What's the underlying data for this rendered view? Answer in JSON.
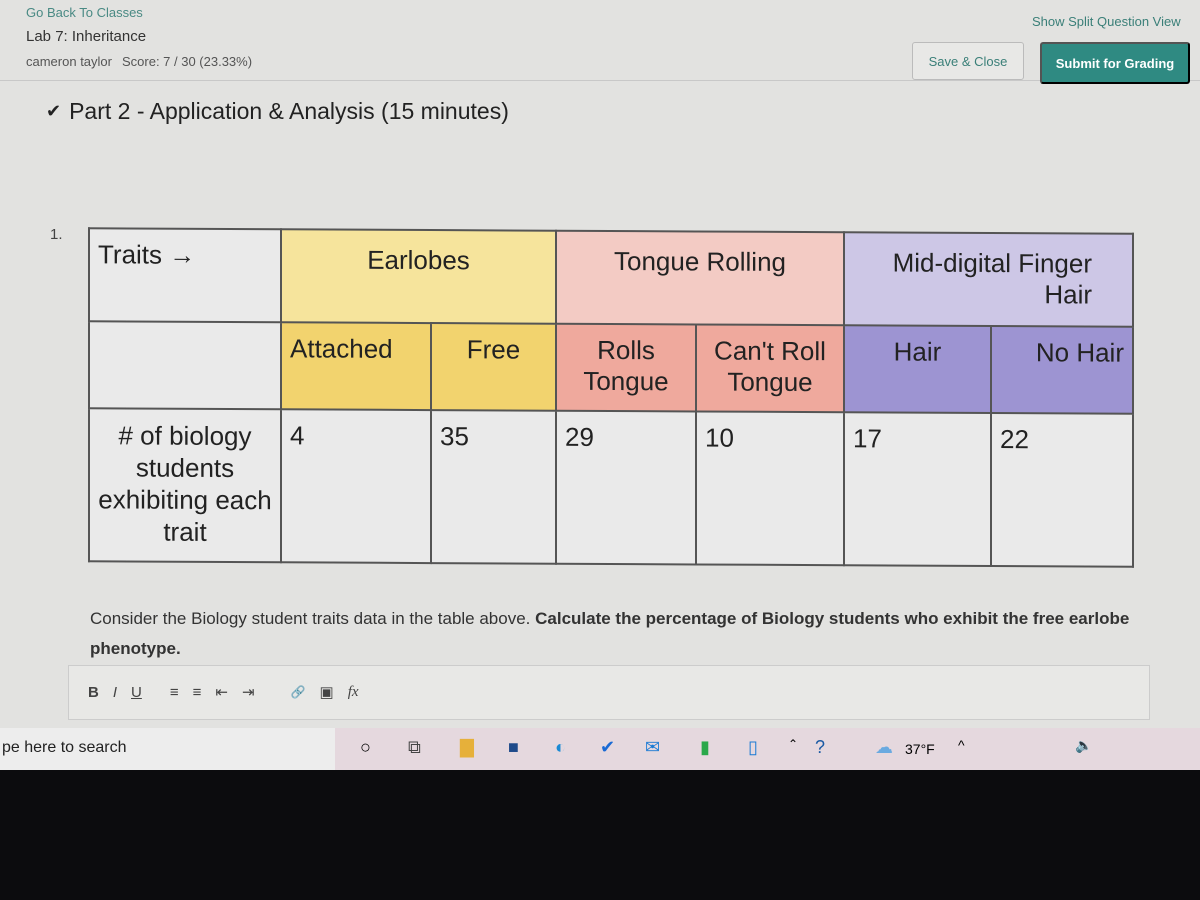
{
  "header": {
    "back_link": "Go Back To Classes",
    "title": "Lab 7: Inheritance",
    "user": "cameron taylor",
    "score": "Score:  7 / 30 (23.33%)",
    "split_view": "Show Split Question View",
    "save_close": "Save & Close",
    "submit": "Submit for Grading"
  },
  "section": {
    "title": "Part 2 - Application & Analysis (15 minutes)"
  },
  "question": {
    "number": "1.",
    "prompt_plain": "Consider the Biology student traits data in the table above.",
    "prompt_bold": "Calculate the percentage of Biology students who exhibit the free earlobe phenotype."
  },
  "table": {
    "traits_label": "Traits →",
    "groups": [
      "Earlobes",
      "Tongue Rolling",
      "Mid-digital Finger Hair"
    ],
    "subheaders": [
      "Attached",
      "Free",
      "Rolls Tongue",
      "Can't Roll Tongue",
      "Hair",
      "No Hair"
    ],
    "row_label": "# of biology students exhibiting each trait",
    "values": [
      "4",
      "35",
      "29",
      "10",
      "17",
      "22"
    ]
  },
  "editor": {
    "tools": [
      "B",
      "I",
      "U",
      "≡",
      "≡",
      "⇤",
      "⇥",
      "🔗",
      "▣",
      "fx"
    ]
  },
  "taskbar": {
    "search_placeholder": "pe here to search",
    "weather": "37°F"
  },
  "colors": {
    "earlobes": "#f6e49c",
    "tongue": "#f3cbc4",
    "finger_hair": "#cdc7e6",
    "accent": "#2f8a82"
  }
}
